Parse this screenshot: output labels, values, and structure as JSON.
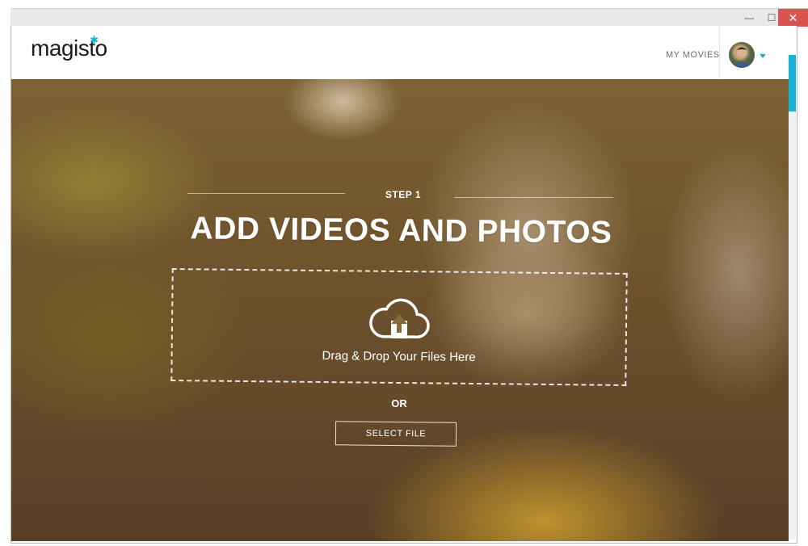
{
  "window": {
    "minimize_glyph": "—",
    "maximize_glyph": "☐",
    "close_glyph": "✕"
  },
  "header": {
    "logo_text": "magisto",
    "nav_my_movies": "MY MOVIES"
  },
  "hero": {
    "step_label": "STEP 1",
    "title": "ADD VIDEOS AND PHOTOS",
    "drop_text": "Drag & Drop Your Files Here",
    "or_text": "OR",
    "select_button_label": "SELECT FILE"
  },
  "icons": {
    "logo_star": "magisto-star-icon",
    "upload": "cloud-upload-icon",
    "avatar": "user-avatar",
    "dropdown": "caret-down-icon"
  },
  "colors": {
    "accent": "#18b1d6",
    "close_button": "#d9534f"
  }
}
